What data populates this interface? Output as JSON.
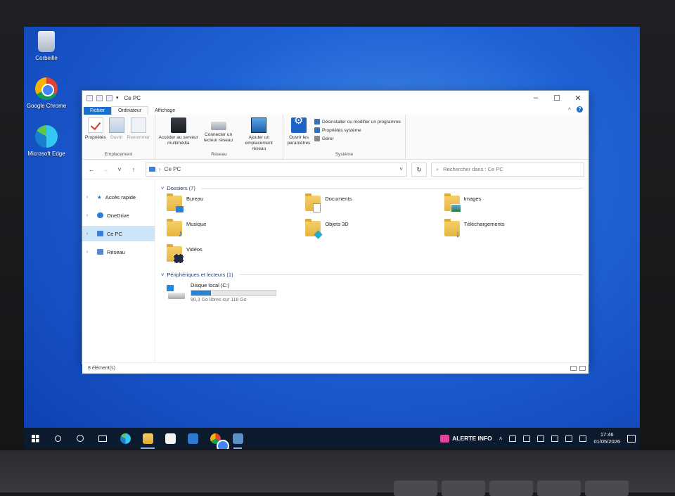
{
  "desktop": {
    "icons": [
      {
        "label": "Corbeille"
      },
      {
        "label": "Google Chrome"
      },
      {
        "label": "Microsoft Edge"
      }
    ]
  },
  "explorer": {
    "title": "Ce PC",
    "tabs": {
      "file": "Fichier",
      "computer": "Ordinateur",
      "view": "Affichage"
    },
    "ribbon": {
      "location_group": "Emplacement",
      "properties": "Propriétés",
      "open": "Ouvrir",
      "rename": "Renommer",
      "network_group": "Réseau",
      "media_server": "Accéder au serveur multimédia",
      "map_drive": "Connecter un lecteur réseau",
      "add_location": "Ajouter un emplacement réseau",
      "system_group": "Système",
      "open_settings": "Ouvrir les paramètres",
      "uninstall": "Désinstaller ou modifier un programme",
      "system_props": "Propriétés système",
      "manage": "Gérer"
    },
    "address": {
      "path": "Ce PC",
      "search_placeholder": "Rechercher dans : Ce PC"
    },
    "nav": [
      {
        "label": "Accès rapide"
      },
      {
        "label": "OneDrive"
      },
      {
        "label": "Ce PC"
      },
      {
        "label": "Réseau"
      }
    ],
    "folders_header": "Dossiers (7)",
    "folders": [
      {
        "name": "Bureau"
      },
      {
        "name": "Documents"
      },
      {
        "name": "Images"
      },
      {
        "name": "Musique"
      },
      {
        "name": "Objets 3D"
      },
      {
        "name": "Téléchargements"
      },
      {
        "name": "Vidéos"
      }
    ],
    "drives_header": "Périphériques et lecteurs (1)",
    "drive": {
      "name": "Disque local (C:)",
      "free": "90,3 Go libres sur 118 Go",
      "used_fraction": 0.235
    },
    "status": "8 élément(s)"
  },
  "taskbar": {
    "alerte": "ALERTE INFO",
    "time": "17:46",
    "date": "01/05/2026"
  },
  "icons": [
    "recycle-bin-icon",
    "chrome-icon",
    "edge-icon",
    "start-icon",
    "search-icon",
    "cortana-icon",
    "task-view-icon",
    "file-explorer-icon",
    "store-icon",
    "mail-icon"
  ],
  "colors": {
    "accent": "#1a6fd1",
    "taskbar": "#0c1a2d",
    "wallpaper": "#1f62d6"
  }
}
